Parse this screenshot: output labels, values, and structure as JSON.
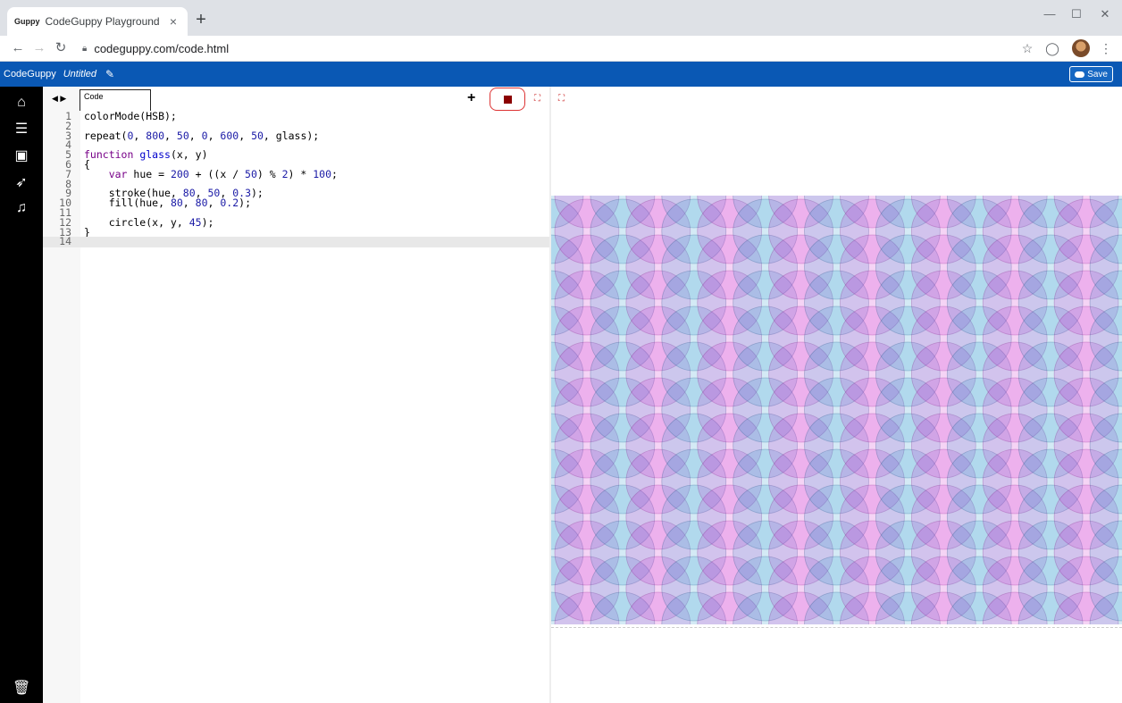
{
  "browser": {
    "tab_title": "CodeGuppy Playground",
    "tab_favicon": "Guppy",
    "tab_close": "×",
    "new_tab": "+",
    "url": "codeguppy.com/code.html",
    "minimize": "—",
    "maximize": "☐",
    "close": "✕"
  },
  "app": {
    "brand": "CodeGuppy",
    "project_name": "Untitled",
    "save_label": "Save",
    "accent_color": "#0a58b4"
  },
  "editor": {
    "tab_label": "Code",
    "add_label": "+",
    "lines": [
      {
        "n": "1",
        "code": "colorMode(HSB);"
      },
      {
        "n": "2",
        "code": ""
      },
      {
        "n": "3",
        "code": "repeat(0, 800, 50, 0, 600, 50, glass);"
      },
      {
        "n": "4",
        "code": ""
      },
      {
        "n": "5",
        "code": "function glass(x, y)"
      },
      {
        "n": "6",
        "code": "{"
      },
      {
        "n": "7",
        "code": "    var hue = 200 + ((x / 50) % 2) * 100;"
      },
      {
        "n": "8",
        "code": ""
      },
      {
        "n": "9",
        "code": "    stroke(hue, 80, 50, 0.3);"
      },
      {
        "n": "10",
        "code": "    fill(hue, 80, 80, 0.2);"
      },
      {
        "n": "11",
        "code": ""
      },
      {
        "n": "12",
        "code": "    circle(x, y, 45);"
      },
      {
        "n": "13",
        "code": "}"
      },
      {
        "n": "14",
        "code": ""
      }
    ]
  },
  "sidebar": {
    "items": [
      "home-icon",
      "menu-icon",
      "image-icon",
      "rocket-icon",
      "music-icon"
    ],
    "bottom": "trash-icon"
  }
}
